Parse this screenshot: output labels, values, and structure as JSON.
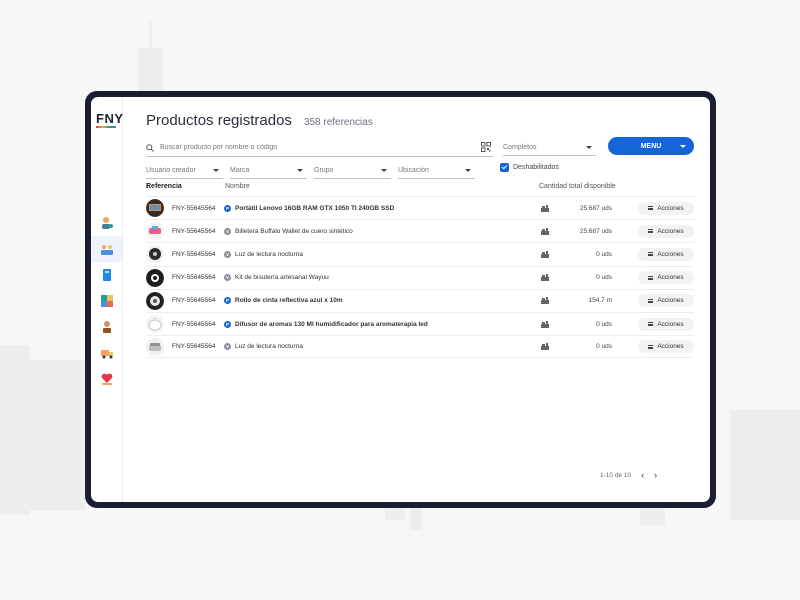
{
  "app": {
    "logo": "FNY",
    "title": "Productos registrados",
    "count": "358 referencias"
  },
  "colors": {
    "primary": "#1565d8",
    "frame": "#1b1e2e",
    "background": "#f7f7f7"
  },
  "sidebar": {
    "items": [
      {
        "icon": "user-settings-icon"
      },
      {
        "icon": "team-icon",
        "active": true
      },
      {
        "icon": "book-icon"
      },
      {
        "icon": "products-icon"
      },
      {
        "icon": "employee-icon"
      },
      {
        "icon": "truck-icon"
      },
      {
        "icon": "heart-hand-icon"
      }
    ]
  },
  "search": {
    "placeholder": "Buscar producto por nombre o código",
    "value": "",
    "qr_icon": "qr-code-icon"
  },
  "filters": {
    "status": "Completos",
    "usuario": "Usuario creador",
    "marca": "Marca",
    "grupo": "Grupo",
    "ubicacion": "Ubicación",
    "deshabilitados_label": "Deshabilitados",
    "deshabilitados_checked": true
  },
  "menu_button": "MENU",
  "table": {
    "headers": {
      "ref": "Referencia",
      "name": "Nombre",
      "qty": "Cantidad total disponible"
    },
    "rows": [
      {
        "ref": "FNY-55645564",
        "badge": "P",
        "name": "Portátil Lenovo 16GB RAM GTX 1050 TI 240GB SSD",
        "bold": true,
        "qty": "25.687 uds",
        "action": "Acciones"
      },
      {
        "ref": "FNY-55645564",
        "badge": "V",
        "name": "Billetera Buffalo Wallet de cuero sintético",
        "bold": false,
        "qty": "25.687 uds",
        "action": "Acciones"
      },
      {
        "ref": "FNY-55645564",
        "badge": "V",
        "name": "Luz de lectura nocturna",
        "bold": false,
        "qty": "0 uds",
        "action": "Acciones"
      },
      {
        "ref": "FNY-55645564",
        "badge": "V",
        "name": "Kit de bisutería artesanal Wayuu",
        "bold": false,
        "qty": "0 uds",
        "action": "Acciones"
      },
      {
        "ref": "FNY-55645564",
        "badge": "P",
        "name": "Rollo de cinta reflectiva azul x 10m",
        "bold": true,
        "qty": "154.7 m",
        "action": "Acciones"
      },
      {
        "ref": "FNY-55645564",
        "badge": "P",
        "name": "Difusor de aromas 130 Ml humidificador para aromaterapia led",
        "bold": true,
        "qty": "0 uds",
        "action": "Acciones"
      },
      {
        "ref": "FNY-55645564",
        "badge": "V",
        "name": "Luz de lectura nocturna",
        "bold": false,
        "qty": "0 uds",
        "action": "Acciones"
      }
    ]
  },
  "pagination": {
    "label": "1-10 de 10"
  }
}
